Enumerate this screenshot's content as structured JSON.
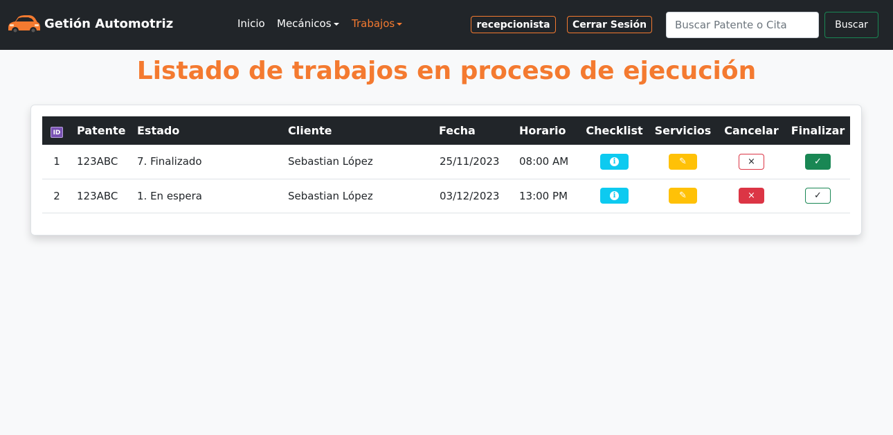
{
  "brand": {
    "name": "Getión Automotriz",
    "icon": "car-icon",
    "accent": "#f47a30"
  },
  "nav": {
    "inicio": "Inicio",
    "mecanicos": "Mecánicos",
    "trabajos": "Trabajos"
  },
  "user": {
    "role": "recepcionista",
    "logout": "Cerrar Sesión"
  },
  "search": {
    "placeholder": "Buscar Patente o Cita",
    "button": "Buscar"
  },
  "title": "Listado de trabajos en proceso de ejecución",
  "table": {
    "headers": {
      "id": "ID",
      "patente": "Patente",
      "estado": "Estado",
      "cliente": "Cliente",
      "fecha": "Fecha",
      "horario": "Horario",
      "checklist": "Checklist",
      "servicios": "Servicios",
      "cancelar": "Cancelar",
      "finalizar": "Finalizar"
    },
    "rows": [
      {
        "id": "1",
        "patente": "123ABC",
        "estado": "7. Finalizado",
        "cliente": "Sebastian López",
        "fecha": "25/11/2023",
        "horario": "08:00 AM",
        "cancel_icon": "×",
        "finish_icon": "✓"
      },
      {
        "id": "2",
        "patente": "123ABC",
        "estado": "1. En espera",
        "cliente": "Sebastian López",
        "fecha": "03/12/2023",
        "horario": "13:00 PM",
        "cancel_icon": "×",
        "finish_icon": "✓"
      }
    ]
  },
  "icons": {
    "checklist": "info-icon",
    "servicios": "pencil-icon",
    "cancelar": "close-icon",
    "finalizar": "check-icon",
    "info_glyph": "i",
    "pencil_glyph": "✎"
  }
}
